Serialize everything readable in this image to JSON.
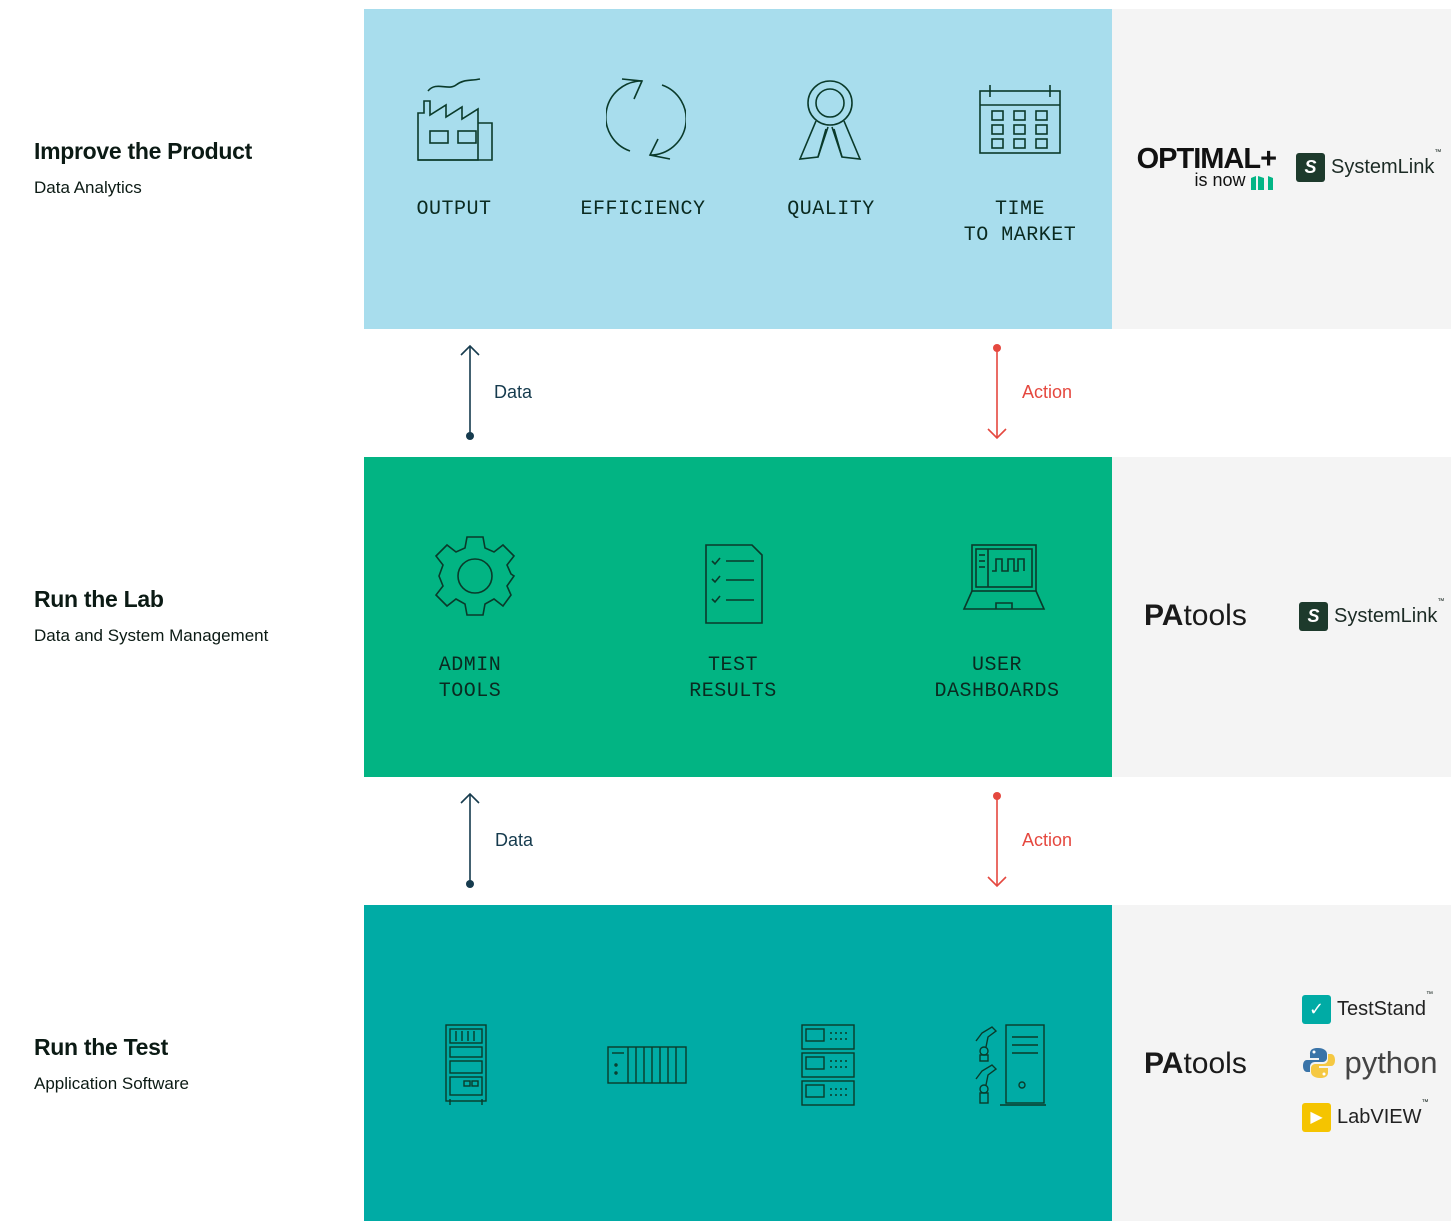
{
  "rows": [
    {
      "title": "Improve the Product",
      "subtitle": "Data Analytics"
    },
    {
      "title": "Run the Lab",
      "subtitle": "Data and System Management"
    },
    {
      "title": "Run the Test",
      "subtitle": "Application Software"
    }
  ],
  "product_items": [
    {
      "line1": "OUTPUT",
      "line2": ""
    },
    {
      "line1": "EFFICIENCY",
      "line2": ""
    },
    {
      "line1": "QUALITY",
      "line2": ""
    },
    {
      "line1": "TIME",
      "line2": "TO MARKET"
    }
  ],
  "lab_items": [
    {
      "line1": "ADMIN",
      "line2": "TOOLS"
    },
    {
      "line1": "TEST",
      "line2": "RESULTS"
    },
    {
      "line1": "USER",
      "line2": "DASHBOARDS"
    }
  ],
  "flows": {
    "data_label": "Data",
    "action_label": "Action"
  },
  "brands": {
    "optimal_main": "OPTIMAL+",
    "optimal_sub": "is now",
    "systemlink": "SystemLink",
    "systemlink_mark": "S",
    "tm": "™",
    "patools_bold": "PA",
    "patools_rest": "tools",
    "teststand": "TestStand",
    "python": "python",
    "labview": "LabVIEW"
  },
  "colors": {
    "product_band": "#a8dded",
    "lab_band": "#02b483",
    "test_band": "#00aba5",
    "side_panel": "#f4f4f4",
    "data_arrow": "#163b4e",
    "action_arrow": "#e5483f",
    "ni_green": "#03b585"
  }
}
